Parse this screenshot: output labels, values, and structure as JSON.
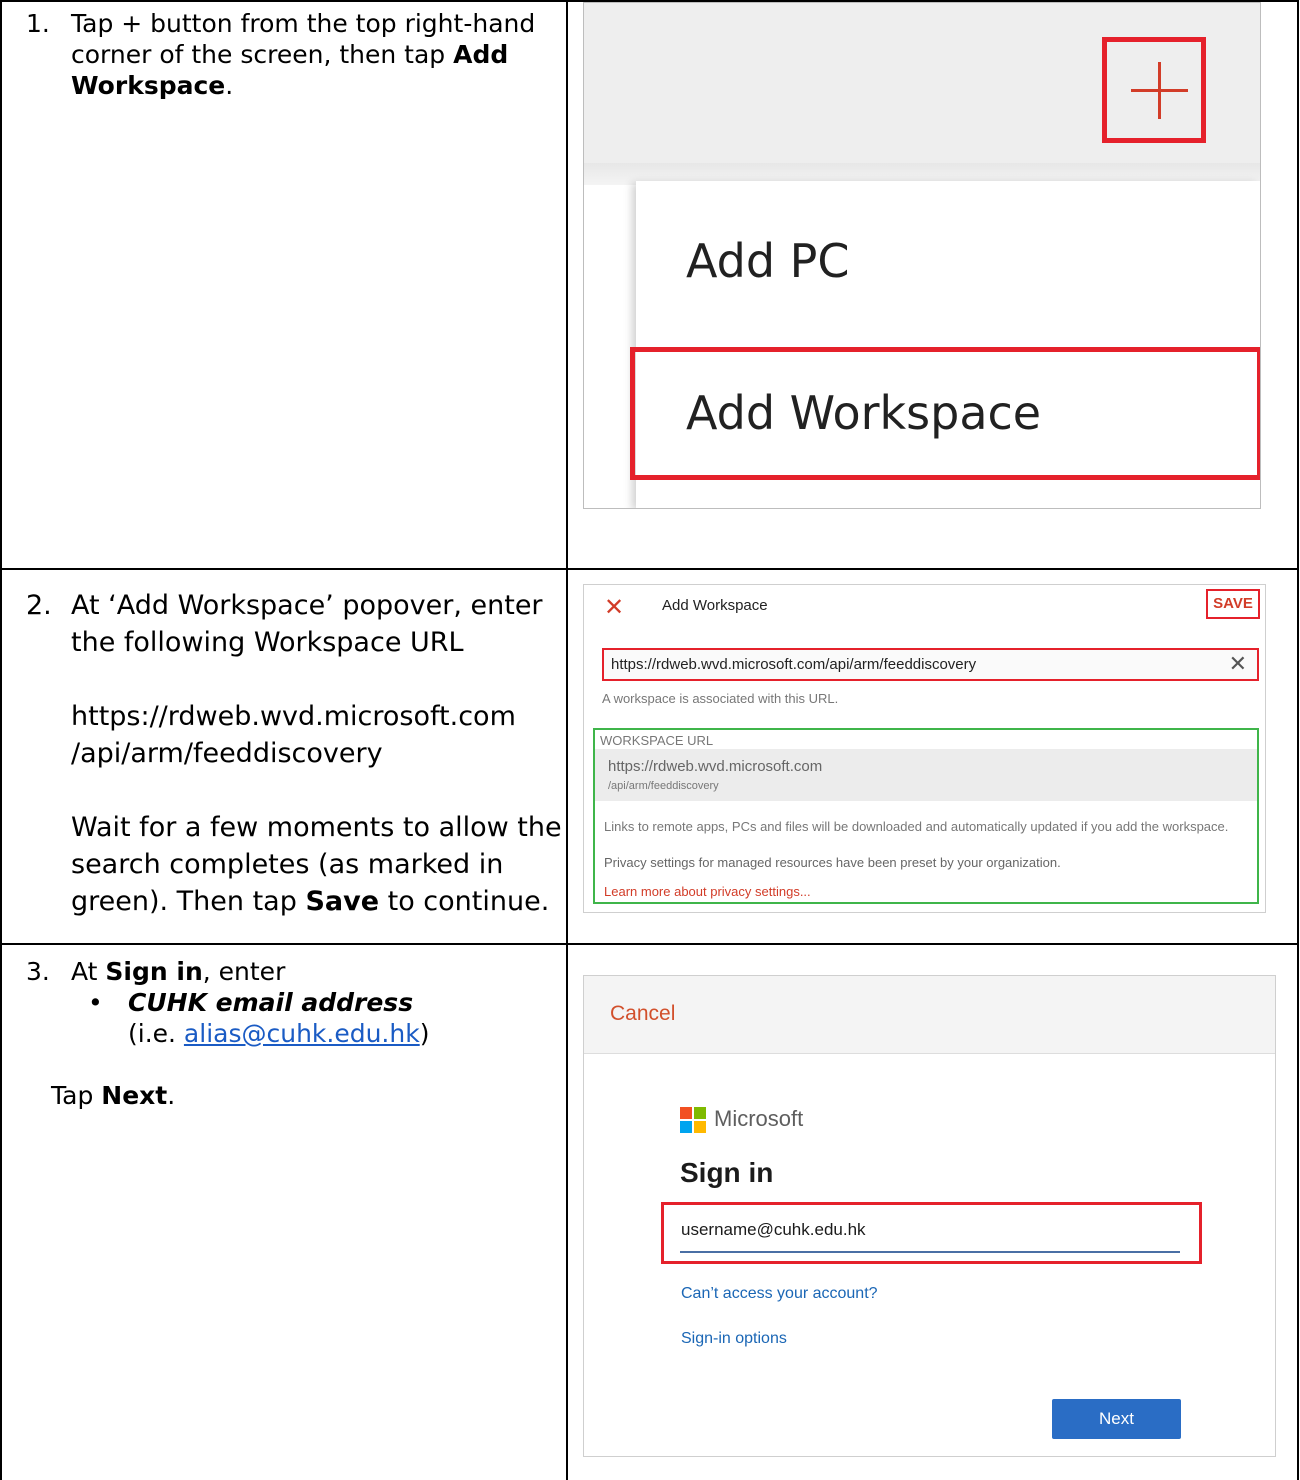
{
  "steps": [
    {
      "num": "1.",
      "lines": [
        "Tap + button from the top right-hand",
        "corner of the screen, then tap "
      ],
      "bold1": "Add",
      "bold2": "Workspace",
      "end": "."
    },
    {
      "num": "2.",
      "line1": "At ‘Add Workspace’ popover, enter",
      "line2": "the following Workspace URL",
      "url1": "https://rdweb.wvd.microsoft.com",
      "url2": "/api/arm/feeddiscovery",
      "wait1": "Wait for a few moments to allow the",
      "wait2": "search completes (as marked in",
      "wait3a": "green).  Then tap ",
      "wait3bold": "Save",
      "wait3b": " to continue."
    },
    {
      "num": "3.",
      "line1a": "At ",
      "line1bold": "Sign in",
      "line1b": ", enter",
      "bullet": "•",
      "bullet_text": "CUHK email address",
      "ie_prefix": "(i.e. ",
      "ie_link": "alias@cuhk.edu.hk",
      "ie_suffix": ")",
      "tap_a": "Tap ",
      "tap_bold": "Next",
      "tap_b": "."
    }
  ],
  "panel1": {
    "plus_icon": "plus-icon",
    "menu_items": [
      "Add PC",
      "Add Workspace"
    ],
    "highlight_color": "#e5212b"
  },
  "panel2": {
    "close_icon": "close-icon",
    "title": "Add Workspace",
    "save_label": "SAVE",
    "url_value": "https://rdweb.wvd.microsoft.com/api/arm/feeddiscovery",
    "clear_icon": "clear-icon",
    "assoc_text": "A workspace is associated with this URL.",
    "ws_label": "WORKSPACE URL",
    "ws_url1": "https://rdweb.wvd.microsoft.com",
    "ws_url2": "/api/arm/feeddiscovery",
    "links_text": "Links to remote apps, PCs and files will be downloaded and automatically updated if you add the workspace.",
    "privacy_text": "Privacy settings for managed resources have been preset by your organization.",
    "learn_text": "Learn more about privacy settings...",
    "green_color": "#3fb54a"
  },
  "panel3": {
    "cancel_label": "Cancel",
    "brand": "Microsoft",
    "heading": "Sign in",
    "email_value": "username@cuhk.edu.hk",
    "cant_access": "Can’t access your account?",
    "signin_options": "Sign-in options",
    "next_label": "Next",
    "logo_colors": [
      "#f25022",
      "#7fba00",
      "#00a4ef",
      "#ffb900"
    ]
  }
}
